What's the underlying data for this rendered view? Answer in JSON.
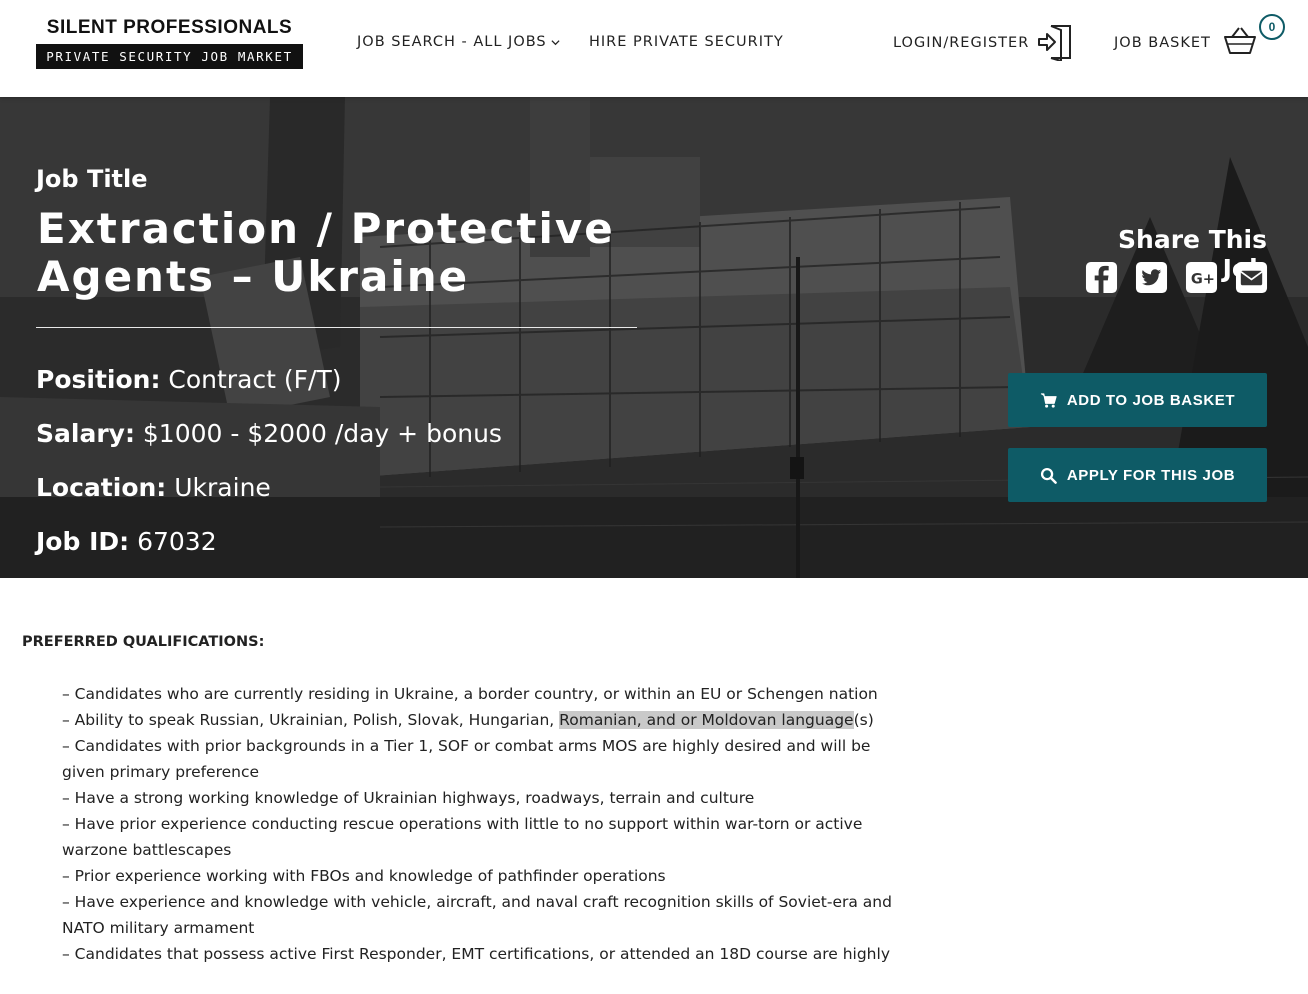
{
  "header": {
    "logo_top": "SILENT PROFESSIONALS",
    "logo_bottom": "PRIVATE SECURITY JOB MARKET",
    "nav_job_search": "JOB SEARCH - ALL JOBS",
    "nav_hire": "HIRE PRIVATE SECURITY",
    "login": "LOGIN/REGISTER",
    "job_basket": "JOB BASKET",
    "basket_count": "0",
    "accent_color": "#0e5b66"
  },
  "hero": {
    "job_label": "Job Title",
    "title": "Extraction / Protective Agents – Ukraine",
    "position_label": "Position:",
    "position_value": "Contract (F/T)",
    "salary_label": "Salary:",
    "salary_value": "$1000 - $2000 /day + bonus",
    "location_label": "Location:",
    "location_value": "Ukraine",
    "jobid_label": "Job ID:",
    "jobid_value": "67032",
    "share_title": "Share This Job",
    "share_icons": [
      "facebook-icon",
      "twitter-icon",
      "google-plus-icon",
      "email-icon"
    ],
    "add_button": "ADD TO JOB BASKET",
    "apply_button": "APPLY FOR THIS JOB"
  },
  "qualifications": {
    "heading": "PREFERRED QUALIFICATIONS:",
    "item1": "– Candidates who are currently residing in Ukraine, a border country, or within an EU or Schengen nation",
    "item2_pre": "– Ability to speak Russian, Ukrainian, Polish, Slovak, Hungarian, ",
    "item2_highlight": "Romanian, and or Moldovan language",
    "item2_post": "(s)",
    "item3": "– Candidates with prior backgrounds in a Tier 1, SOF or combat arms MOS are highly desired and will be given primary preference",
    "item4": "– Have a strong working knowledge of Ukrainian highways, roadways, terrain and culture",
    "item5": "– Have prior experience conducting rescue operations with little to no support within war-torn or active warzone battlescapes",
    "item6": "– Prior experience working with FBOs and knowledge of pathfinder operations",
    "item7": "– Have experience and knowledge with vehicle, aircraft, and naval craft recognition skills of Soviet-era and NATO military armament",
    "item8": "– Candidates that possess active First Responder, EMT certifications, or attended an 18D course are highly"
  }
}
